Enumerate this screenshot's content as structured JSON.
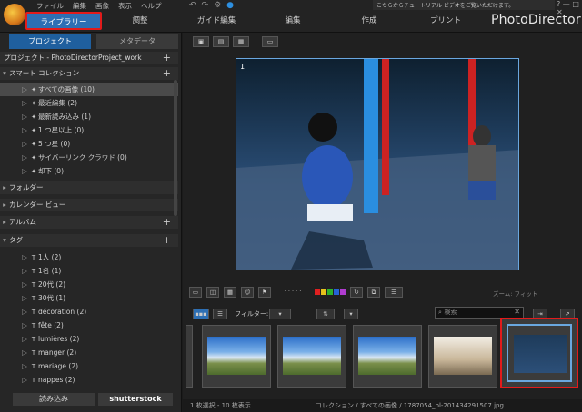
{
  "menu": [
    "ファイル",
    "編集",
    "画像",
    "表示",
    "ヘルプ"
  ],
  "tutorial_text": "こちらからチュートリアル ビデオをご覧いただけます。",
  "brand": "PhotoDirector",
  "window_controls": "? — □ ✕",
  "tabs": [
    "ライブラリー",
    "調整",
    "ガイド編集",
    "編集",
    "作成",
    "プリント"
  ],
  "left_tabs": {
    "project": "プロジェクト",
    "meta": "メタデータ"
  },
  "project_label": "プロジェクト - PhotoDirectorProject_work",
  "smart_collection": "スマート コレクション",
  "collections": [
    "すべての画像 (10)",
    "最近編集 (2)",
    "最新読み込み (1)",
    "1 つ星以上 (0)",
    "5 つ星 (0)",
    "サイバーリンク クラウド (0)",
    "却下 (0)"
  ],
  "folder": "フォルダー",
  "calendar": "カレンダー ビュー",
  "album": "アルバム",
  "tag": "タグ",
  "tags": [
    "1人 (2)",
    "1名 (1)",
    "20代 (2)",
    "30代 (1)",
    "décoration (2)",
    "fête (2)",
    "lumières (2)",
    "manger (2)",
    "mariage (2)",
    "nappes (2)"
  ],
  "import_label": "読み込み",
  "shutterstock_label": "shutterstock",
  "photo_index": "1",
  "filter_label": "フィルター:",
  "search_placeholder": "検索",
  "zoom_label": "ズーム:  フィット",
  "status_left": "1 枚選択 - 10 枚表示",
  "status_right": "コレクション / すべての画像 / 1787054_pl-201434291507.jpg",
  "colors": {
    "accent": "#2d6fb4",
    "highlight": "#e21b1b",
    "selection": "#6aa7df"
  }
}
